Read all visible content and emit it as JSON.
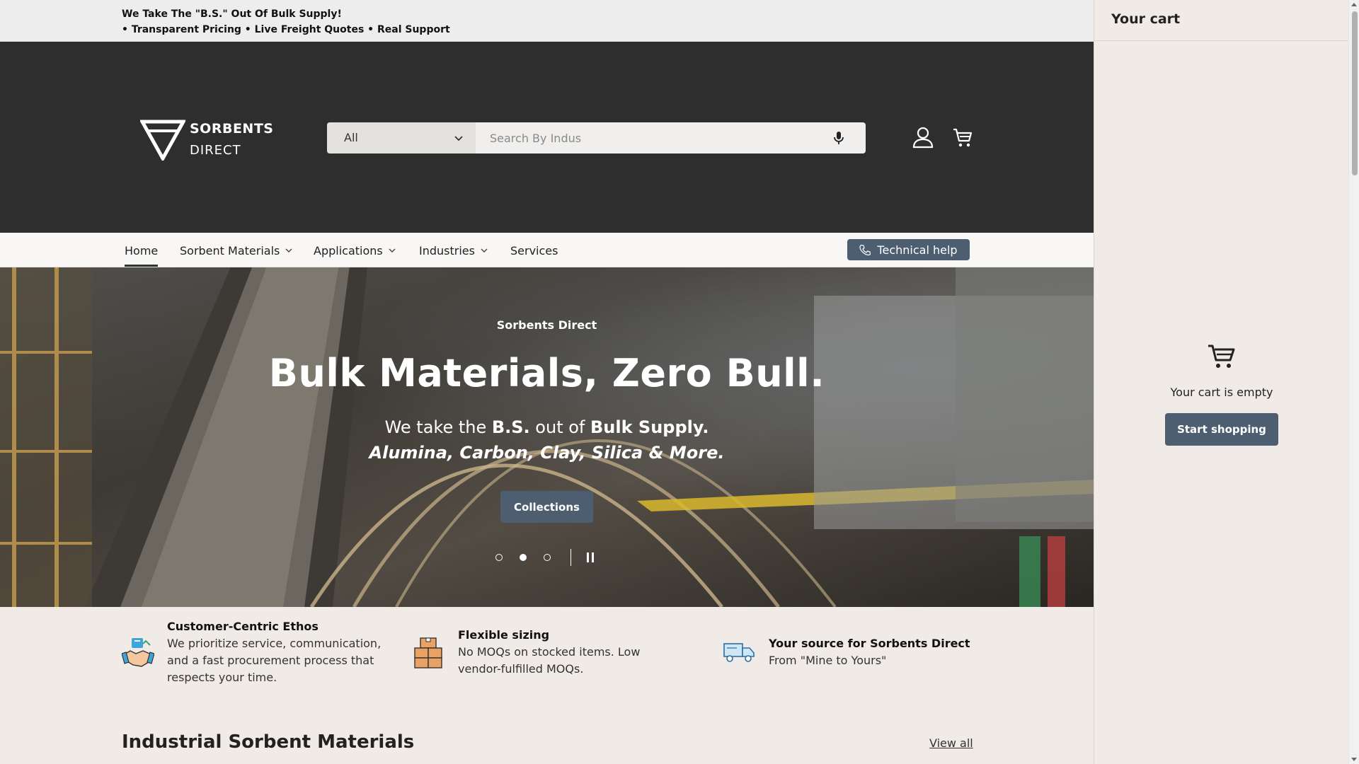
{
  "announcement": {
    "line1": "We Take The \"B.S.\" Out Of Bulk Supply!",
    "line2": "• Transparent Pricing • Live Freight Quotes • Real Support"
  },
  "header": {
    "logo_line1": "SORBENTS",
    "logo_line2": "DIRECT",
    "search": {
      "category_selected": "All",
      "placeholder": "Search By Indus",
      "value": ""
    },
    "icons": [
      "account-icon",
      "cart-icon",
      "microphone-icon"
    ]
  },
  "nav": {
    "items": [
      {
        "label": "Home",
        "active": true
      },
      {
        "label": "Sorbent Materials",
        "has_dropdown": true
      },
      {
        "label": "Applications",
        "has_dropdown": true
      },
      {
        "label": "Industries",
        "has_dropdown": true
      },
      {
        "label": "Services"
      }
    ],
    "tech_help_label": "Technical help"
  },
  "hero": {
    "eyebrow": "Sorbents Direct",
    "title": "Bulk Materials, Zero Bull.",
    "sub1_a": "We take the ",
    "sub1_b": "B.S.",
    "sub1_c": " out of ",
    "sub1_d": "Bulk Supply.",
    "sub2": "Alumina, Carbon, Clay, Silica & More.",
    "button_label": "Collections",
    "slide_count": 3,
    "active_slide": 2
  },
  "features": [
    {
      "title": "Customer-Centric Ethos",
      "description": "We prioritize service, communication, and a fast procurement process that respects your time.",
      "icon": "handshake-icon"
    },
    {
      "title": "Flexible sizing",
      "description": "No MOQs on stocked items. Low vendor-fulfilled MOQs.",
      "icon": "boxes-icon"
    },
    {
      "title": "Your source for Sorbents Direct",
      "description": "From \"Mine to Yours\"",
      "icon": "delivery-truck-icon"
    }
  ],
  "section": {
    "title": "Industrial Sorbent Materials",
    "view_all": "View all"
  },
  "cart": {
    "title": "Your cart",
    "empty_text": "Your cart is empty",
    "start_shopping": "Start shopping"
  },
  "colors": {
    "header_bg": "#2e2e2e",
    "button_bg": "#4d5e70",
    "page_bg": "#f0ebe6",
    "announce_bg": "#ededed"
  }
}
